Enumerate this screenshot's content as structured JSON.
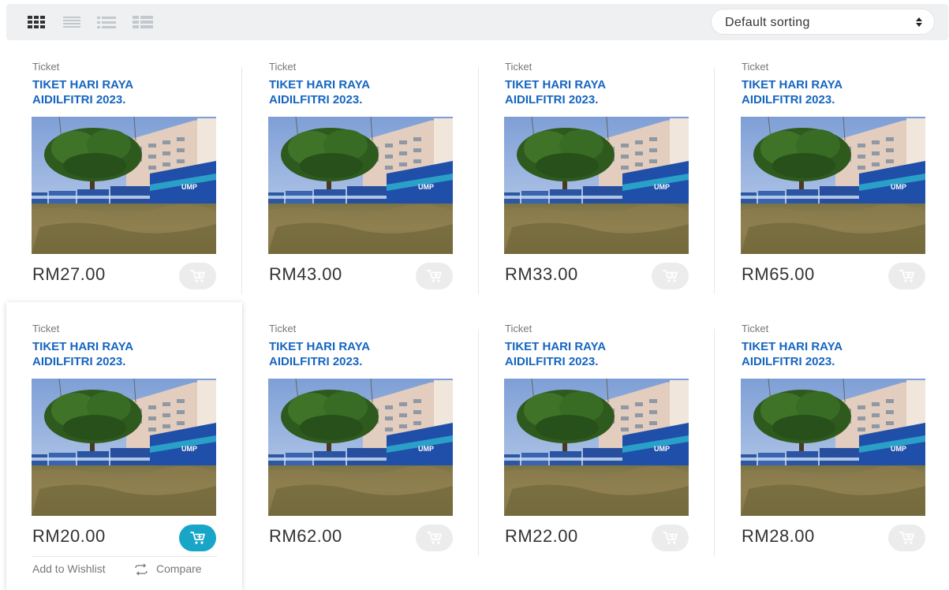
{
  "toolbar": {
    "view_modes": [
      "grid-view-icon",
      "list-view-icon",
      "detailed-list-view-icon",
      "table-view-icon"
    ],
    "active_view": "grid-view-icon",
    "sorting": {
      "selected": "Default sorting"
    }
  },
  "colors": {
    "title": "#1565c0",
    "cart_active": "#17a5c8",
    "cart_inactive": "#ececec",
    "toolbar_bg": "#eef0f2"
  },
  "products": [
    {
      "category": "Ticket",
      "title": "TIKET HARI RAYA AIDILFITRI 2023.",
      "price": "RM27.00"
    },
    {
      "category": "Ticket",
      "title": "TIKET HARI RAYA AIDILFITRI 2023.",
      "price": "RM43.00"
    },
    {
      "category": "Ticket",
      "title": "TIKET HARI RAYA AIDILFITRI 2023.",
      "price": "RM33.00"
    },
    {
      "category": "Ticket",
      "title": "TIKET HARI RAYA AIDILFITRI 2023.",
      "price": "RM65.00"
    },
    {
      "category": "Ticket",
      "title": "TIKET HARI RAYA AIDILFITRI 2023.",
      "price": "RM20.00",
      "hovered": true,
      "wishlist_label": "Add to Wishlist",
      "compare_label": "Compare"
    },
    {
      "category": "Ticket",
      "title": "TIKET HARI RAYA AIDILFITRI 2023.",
      "price": "RM62.00"
    },
    {
      "category": "Ticket",
      "title": "TIKET HARI RAYA AIDILFITRI 2023.",
      "price": "RM22.00"
    },
    {
      "category": "Ticket",
      "title": "TIKET HARI RAYA AIDILFITRI 2023.",
      "price": "RM28.00"
    }
  ]
}
